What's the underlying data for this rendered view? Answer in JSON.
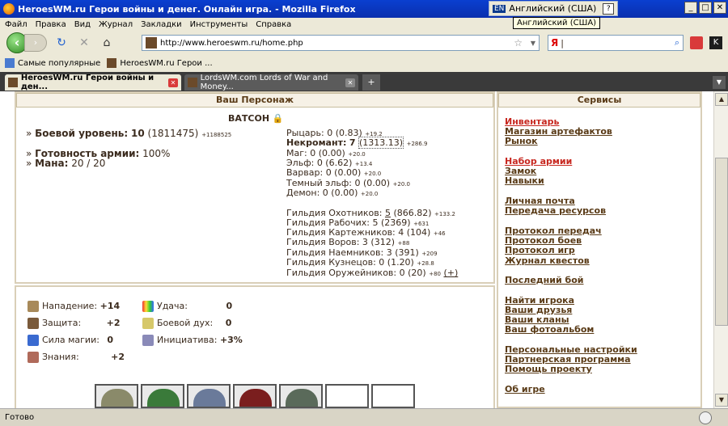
{
  "window": {
    "title": "HeroesWM.ru Герои войны и денег. Онлайн игра. - Mozilla Firefox",
    "lang_code": "EN",
    "lang_name": "Английский (США)",
    "lang_tooltip": "Английский (США)",
    "help_btn": "?"
  },
  "menu": [
    "Файл",
    "Правка",
    "Вид",
    "Журнал",
    "Закладки",
    "Инструменты",
    "Справка"
  ],
  "nav": {
    "url": "http://www.heroeswm.ru/home.php",
    "search_engine": "Я",
    "search_value": "|"
  },
  "bookmarks": [
    "Самые популярные",
    "HeroesWM.ru Герои ..."
  ],
  "tabs": [
    {
      "label": "HeroesWM.ru Герои войны и ден...",
      "active": true
    },
    {
      "label": "LordsWM.com Lords of War and Money...",
      "active": false
    }
  ],
  "page": {
    "char_panel_title": "Ваш Персонаж",
    "services_title": "Сервисы",
    "char_name": "ВАТСОН",
    "combat_level_label": "Боевой уровень:",
    "combat_level_value": "10",
    "combat_exp": "(1811475)",
    "combat_exp_delta": "+1188525",
    "army_ready_label": "Готовность армии:",
    "army_ready_value": "100%",
    "mana_label": "Мана:",
    "mana_value": "20 / 20",
    "factions": [
      {
        "name": "Рыцарь:",
        "value": "0 (0.83)",
        "delta": "+19.2"
      },
      {
        "name": "Некромант:",
        "value": "7",
        "extra": "(1313.13)",
        "delta": "+286.9"
      },
      {
        "name": "Маг:",
        "value": "0 (0.00)",
        "delta": "+20.0"
      },
      {
        "name": "Эльф:",
        "value": "0 (6.62)",
        "delta": "+13.4"
      },
      {
        "name": "Варвар:",
        "value": "0 (0.00)",
        "delta": "+20.0"
      },
      {
        "name": "Темный эльф:",
        "value": "0 (0.00)",
        "delta": "+20.0"
      },
      {
        "name": "Демон:",
        "value": "0 (0.00)",
        "delta": "+20.0"
      }
    ],
    "guilds": [
      {
        "name": "Гильдия Охотников:",
        "value": "5",
        "extra": "(866.82)",
        "delta": "+133.2"
      },
      {
        "name": "Гильдия Рабочих:",
        "value": "5 (2369)",
        "delta": "+631"
      },
      {
        "name": "Гильдия Картежников:",
        "value": "4 (104)",
        "delta": "+46"
      },
      {
        "name": "Гильдия Воров:",
        "value": "3 (312)",
        "delta": "+88"
      },
      {
        "name": "Гильдия Наемников:",
        "value": "3 (391)",
        "delta": "+209"
      },
      {
        "name": "Гильдия Кузнецов:",
        "value": "0 (1.20)",
        "delta": "+28.8"
      },
      {
        "name": "Гильдия Оружейников:",
        "value": "0 (20)",
        "delta": "+80",
        "plus": "(+)"
      }
    ],
    "stats": [
      {
        "label": "Нападение:",
        "value": "+14"
      },
      {
        "label": "Защита:",
        "value": "+2"
      },
      {
        "label": "Сила магии:",
        "value": "0"
      },
      {
        "label": "Знания:",
        "value": "+2"
      }
    ],
    "stats2": [
      {
        "label": "Удача:",
        "value": "0"
      },
      {
        "label": "Боевой дух:",
        "value": "0"
      },
      {
        "label": "Инициатива:",
        "value": "+3%"
      }
    ],
    "services": [
      {
        "label": "Инвентарь",
        "red": true
      },
      {
        "label": "Магазин артефактов"
      },
      {
        "label": "Рынок"
      },
      {
        "label": "Набор армии",
        "red": true
      },
      {
        "label": "Замок"
      },
      {
        "label": "Навыки"
      },
      {
        "label": "Личная почта"
      },
      {
        "label": "Передача ресурсов"
      },
      {
        "label": "Протокол передач"
      },
      {
        "label": "Протокол боев"
      },
      {
        "label": "Протокол игр"
      },
      {
        "label": "Журнал квестов"
      },
      {
        "label": "Последний бой"
      },
      {
        "label": "Найти игрока"
      },
      {
        "label": "Ваши друзья"
      },
      {
        "label": "Ваши кланы"
      },
      {
        "label": "Ваш фотоальбом"
      },
      {
        "label": "Персональные настройки"
      },
      {
        "label": "Партнерская программа"
      },
      {
        "label": "Помощь проекту"
      },
      {
        "label": "Об игре"
      }
    ]
  },
  "status": {
    "text": "Готово"
  },
  "colors": {
    "accent": "#593a16",
    "link_red": "#c7271f",
    "panel_border": "#d9cfb8",
    "titlebar": "#0a3fd0"
  }
}
